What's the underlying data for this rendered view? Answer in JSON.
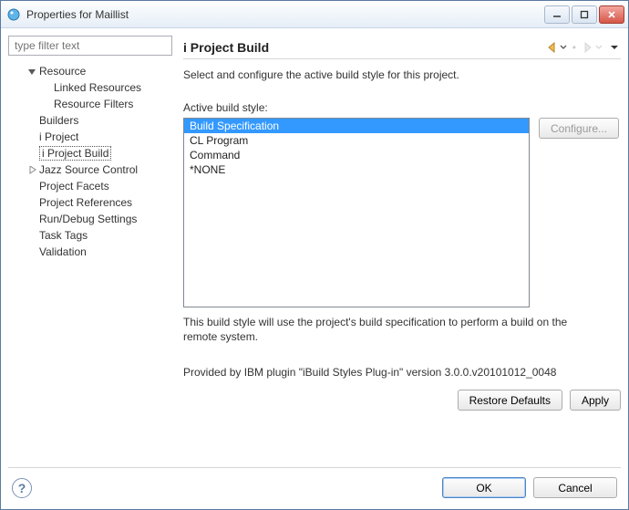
{
  "window": {
    "title": "Properties for Maillist"
  },
  "filter": {
    "placeholder": "type filter text"
  },
  "tree": [
    {
      "label": "Resource",
      "level": 1,
      "expanded": true,
      "hasChildren": true
    },
    {
      "label": "Linked Resources",
      "level": 2
    },
    {
      "label": "Resource Filters",
      "level": 2
    },
    {
      "label": "Builders",
      "level": 1
    },
    {
      "label": "i Project",
      "level": 1
    },
    {
      "label": "i Project Build",
      "level": 1,
      "selected": true
    },
    {
      "label": "Jazz Source Control",
      "level": 1,
      "expanded": false,
      "hasChildren": true
    },
    {
      "label": "Project Facets",
      "level": 1
    },
    {
      "label": "Project References",
      "level": 1
    },
    {
      "label": "Run/Debug Settings",
      "level": 1
    },
    {
      "label": "Task Tags",
      "level": 1
    },
    {
      "label": "Validation",
      "level": 1
    }
  ],
  "page": {
    "title": "i Project Build",
    "instruction": "Select and configure the active build style for this project.",
    "list_label": "Active build style:",
    "styles": [
      {
        "label": "Build Specification",
        "selected": true
      },
      {
        "label": "CL Program"
      },
      {
        "label": "Command"
      },
      {
        "label": "*NONE"
      }
    ],
    "configure_label": "Configure...",
    "description": "This build style will use the project's build specification to perform a build on the remote system.",
    "provided": "Provided by IBM plugin \"iBuild Styles Plug-in\" version 3.0.0.v20101012_0048"
  },
  "buttons": {
    "restore": "Restore Defaults",
    "apply": "Apply",
    "ok": "OK",
    "cancel": "Cancel"
  }
}
